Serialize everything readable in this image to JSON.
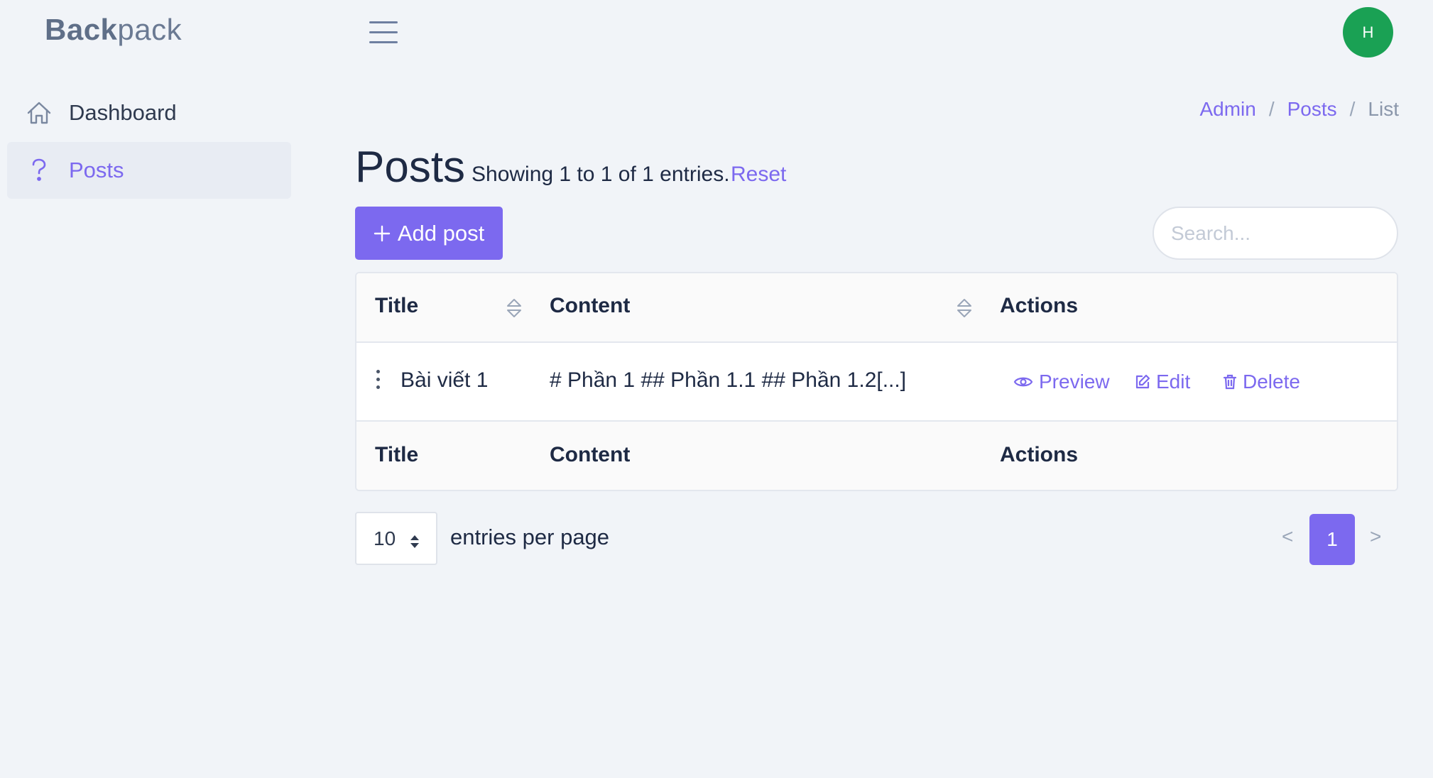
{
  "brand": {
    "bold": "Back",
    "light": "pack"
  },
  "user": {
    "avatar_initial": "H",
    "avatar_color": "#1aa154"
  },
  "sidebar": {
    "items": [
      {
        "label": "Dashboard",
        "icon": "home-icon",
        "active": false
      },
      {
        "label": "Posts",
        "icon": "question-icon",
        "active": true
      }
    ]
  },
  "breadcrumb": {
    "items": [
      "Admin",
      "Posts",
      "List"
    ],
    "separator": "/"
  },
  "page": {
    "title": "Posts",
    "subtitle": "Showing 1 to 1 of 1 entries.",
    "reset_label": "Reset"
  },
  "toolbar": {
    "add_label": "Add post",
    "search_placeholder": "Search..."
  },
  "table": {
    "columns": [
      "Title",
      "Content",
      "Actions"
    ],
    "rows": [
      {
        "title": "Bài viết 1",
        "content": "# Phần 1 ## Phần 1.1 ## Phần 1.2[...]"
      }
    ],
    "actions": {
      "preview": "Preview",
      "edit": "Edit",
      "delete": "Delete"
    }
  },
  "pagination": {
    "per_page": "10",
    "per_page_label": "entries per page",
    "prev": "<",
    "current": "1",
    "next": ">"
  },
  "colors": {
    "accent": "#7c69ef",
    "background": "#f1f4f8"
  }
}
